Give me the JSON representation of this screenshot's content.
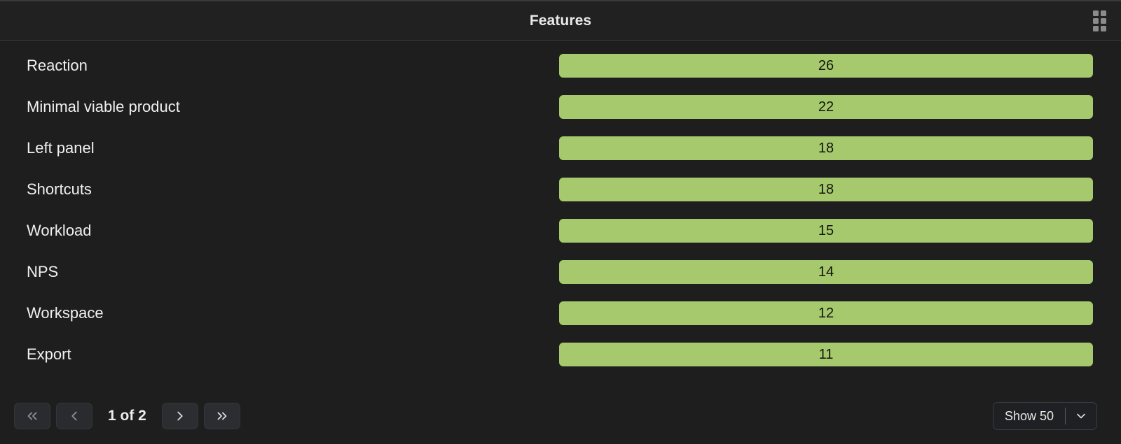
{
  "header": {
    "title": "Features",
    "drag_handle_icon": "grid-dots-icon"
  },
  "colors": {
    "bar_fill": "#a5c96c",
    "bar_value_text": "#14140f",
    "panel_background": "#1e1e1e",
    "header_background": "#212121",
    "label_text": "#f0f0f0"
  },
  "chart_data": {
    "type": "bar",
    "title": "Features",
    "orientation": "horizontal",
    "xlabel": "",
    "ylabel": "",
    "grid": false,
    "legend": null,
    "value_labels_inside_bars": true,
    "bars_normalized_full_width": true,
    "categories": [
      "Reaction",
      "Minimal viable product",
      "Left panel",
      "Shortcuts",
      "Workload",
      "NPS",
      "Workspace",
      "Export"
    ],
    "values": [
      26,
      22,
      18,
      18,
      15,
      14,
      12,
      11
    ],
    "rows": [
      {
        "label": "Reaction",
        "value": "26"
      },
      {
        "label": "Minimal viable product",
        "value": "22"
      },
      {
        "label": "Left panel",
        "value": "18"
      },
      {
        "label": "Shortcuts",
        "value": "18"
      },
      {
        "label": "Workload",
        "value": "15"
      },
      {
        "label": "NPS",
        "value": "14"
      },
      {
        "label": "Workspace",
        "value": "12"
      },
      {
        "label": "Export",
        "value": "11"
      }
    ]
  },
  "footer": {
    "pagination": {
      "first_icon": "chevrons-left-icon",
      "prev_icon": "chevron-left-icon",
      "next_icon": "chevron-right-icon",
      "last_icon": "chevrons-right-icon",
      "indicator": "1 of 2",
      "current_page": 1,
      "total_pages": 2
    },
    "page_size": {
      "label": "Show 50",
      "caret_icon": "chevron-down-icon"
    }
  }
}
